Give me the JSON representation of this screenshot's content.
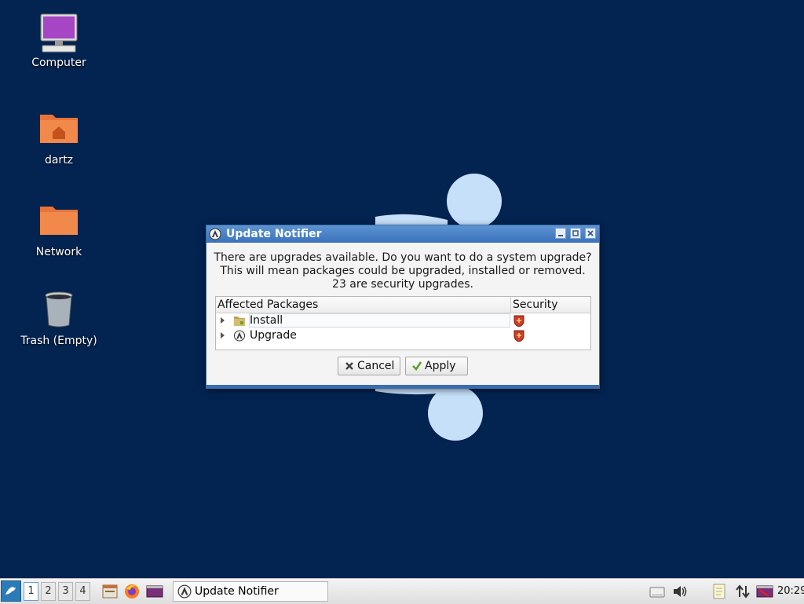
{
  "desktop": {
    "icons": [
      {
        "label": "Computer"
      },
      {
        "label": "dartz"
      },
      {
        "label": "Network"
      },
      {
        "label": "Trash (Empty)"
      }
    ]
  },
  "dialog": {
    "title": "Update Notifier",
    "message_lines": [
      "There are upgrades available. Do you want to do a system upgrade?",
      "This will mean packages could be upgraded, installed or removed.",
      "23 are security upgrades."
    ],
    "table": {
      "columns": [
        "Affected Packages",
        "Security"
      ],
      "rows": [
        {
          "label": "Install",
          "icon": "package-folder-icon",
          "security": "shield-icon"
        },
        {
          "label": "Upgrade",
          "icon": "update-notifier-icon",
          "security": "shield-icon"
        }
      ]
    },
    "buttons": {
      "cancel": "Cancel",
      "apply": "Apply"
    }
  },
  "taskbar": {
    "workspaces": [
      "1",
      "2",
      "3",
      "4"
    ],
    "active_workspace": "1",
    "task_title": "Update Notifier",
    "clock": "20:29"
  },
  "colors": {
    "desktop_bg": "#032350",
    "wallpaper_accent": "#c6e0fa",
    "titlebar": "#4a84c8"
  }
}
